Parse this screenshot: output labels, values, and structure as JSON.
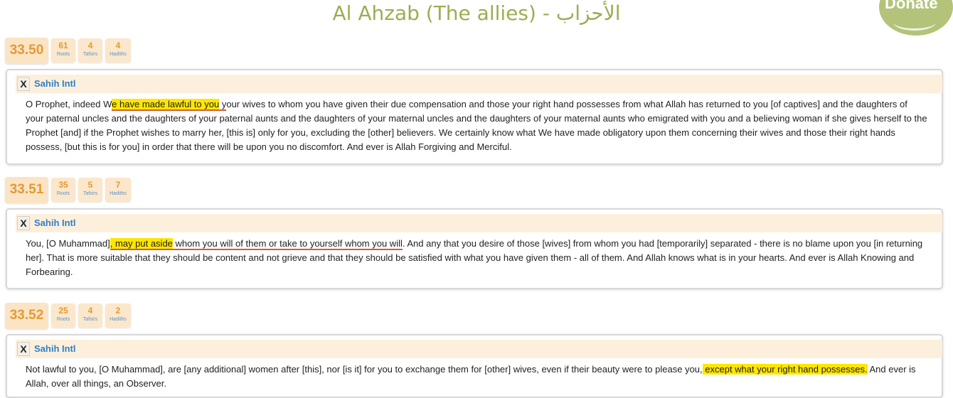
{
  "page": {
    "title": "Al Ahzab (The allies) - الأحزاب",
    "donate_label": "Donate"
  },
  "verses": [
    {
      "number": "33.50",
      "stats": [
        {
          "count": "61",
          "label": "Roots"
        },
        {
          "count": "4",
          "label": "Tafsirs"
        },
        {
          "count": "4",
          "label": "Hadiths"
        }
      ],
      "translation_name": "Sahih Intl",
      "close_label": "X",
      "text_parts": [
        "O Prophet, indeed W",
        "e have made lawful to you",
        " y",
        "our wives to whom you have given their due compensation and those your right hand possesses from what Allah has returned to you [of captives] and the daughters of your paternal uncles and the daughters of your paternal aunts and the daughters of your maternal uncles and the daughters of your maternal aunts who emigrated with you and a believing woman if she gives herself to the Prophet [and] if the Prophet wishes to marry her, [this is] only for you, excluding the [other] believers. We certainly know what We have made obligatory upon them concerning their wives and those their right hands possess, [but this is for you] in order that there will be upon you no discomfort. And ever is Allah Forgiving and Merciful."
      ]
    },
    {
      "number": "33.51",
      "stats": [
        {
          "count": "35",
          "label": "Roots"
        },
        {
          "count": "5",
          "label": "Tafsirs"
        },
        {
          "count": "7",
          "label": "Hadiths"
        }
      ],
      "translation_name": "Sahih Intl",
      "close_label": "X",
      "text_parts": [
        "You, [O Muhammad]",
        ", may put aside",
        " whom you will of them or take to yourself whom you will",
        ". And any that you desire of those [wives] from whom you had [temporarily] separated - there is no blame upon you [in returning her]. That is more suitable that they should be content and not grieve and that they should be satisfied with what you have given them - all of them. And Allah knows what is in your hearts. And ever is Allah Knowing and Forbearing."
      ]
    },
    {
      "number": "33.52",
      "stats": [
        {
          "count": "25",
          "label": "Roots"
        },
        {
          "count": "4",
          "label": "Tafsirs"
        },
        {
          "count": "2",
          "label": "Hadiths"
        }
      ],
      "translation_name": "Sahih Intl",
      "close_label": "X",
      "text_parts": [
        "Not lawful to you, [O Muhammad], are [any additional] women after [this], nor [is it] for you to exchange them for [other] wives, even if their beauty were to please you,",
        " except what your right hand possesses.",
        " And ever is Allah, over all things, an Observer."
      ]
    }
  ],
  "colors": {
    "title": "#9aae52",
    "verse_number": "#e39a36",
    "stat_label": "#5a95c8",
    "translation_name": "#2f7fc8",
    "highlight": "#ffe600",
    "underline": "#d45a3a"
  }
}
